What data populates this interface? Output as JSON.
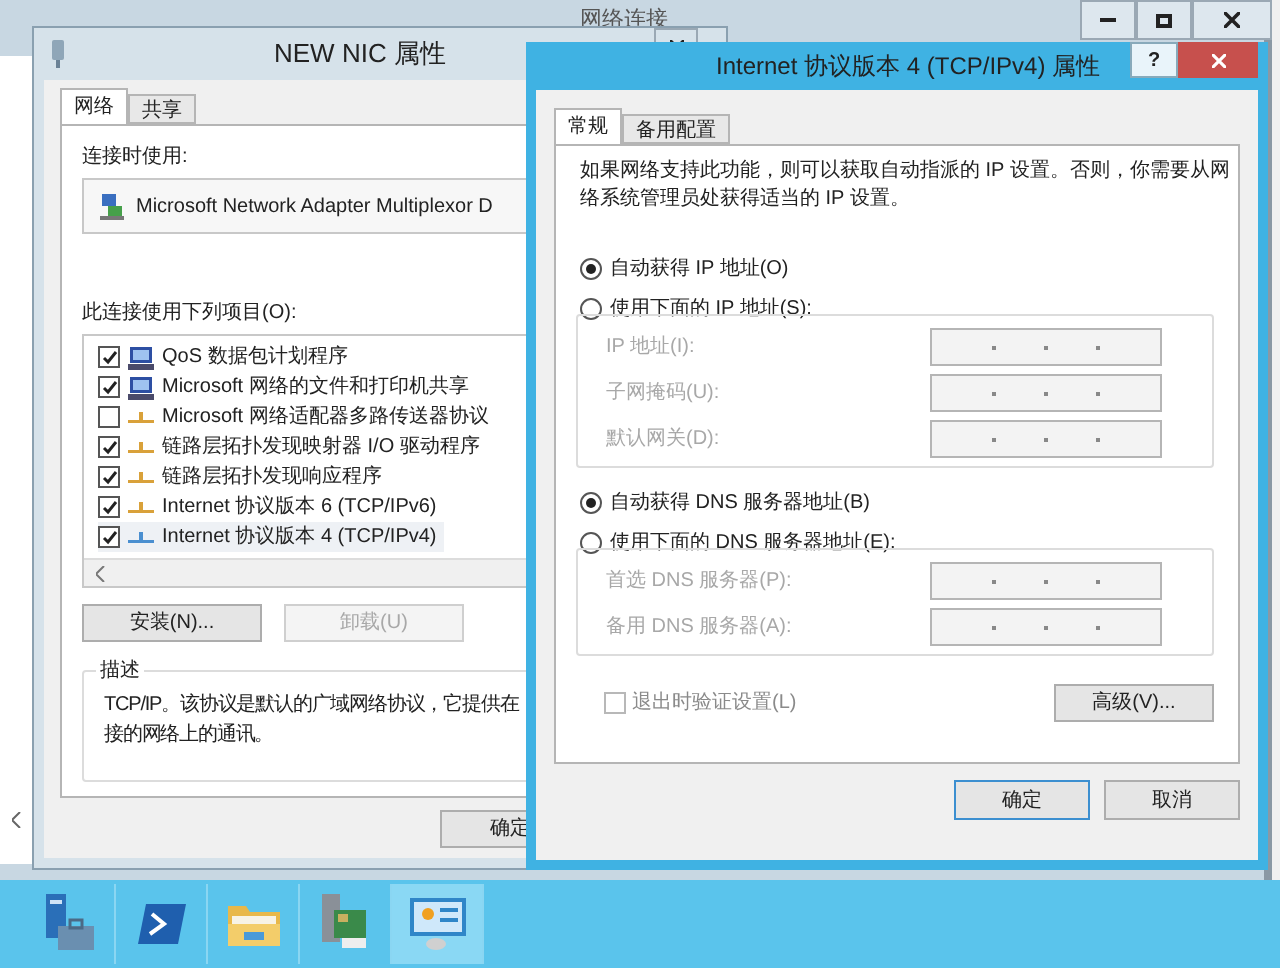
{
  "background_window": {
    "title": "网络连接"
  },
  "nic_window": {
    "title": "NEW NIC 属性",
    "tabs": [
      {
        "label": "网络",
        "selected": true
      },
      {
        "label": "共享",
        "selected": false
      }
    ],
    "connect_using_label": "连接时使用:",
    "adapter": "Microsoft Network Adapter Multiplexor D",
    "items_label": "此连接使用下列项目(O):",
    "items": [
      {
        "label": "QoS 数据包计划程序",
        "checked": true,
        "selected": false,
        "kind": "service"
      },
      {
        "label": "Microsoft 网络的文件和打印机共享",
        "checked": true,
        "selected": false,
        "kind": "service"
      },
      {
        "label": "Microsoft 网络适配器多路传送器协议",
        "checked": false,
        "selected": false,
        "kind": "protocol",
        "color": "#d9a13a"
      },
      {
        "label": "链路层拓扑发现映射器 I/O 驱动程序",
        "checked": true,
        "selected": false,
        "kind": "protocol",
        "color": "#d9a13a"
      },
      {
        "label": "链路层拓扑发现响应程序",
        "checked": true,
        "selected": false,
        "kind": "protocol",
        "color": "#d9a13a"
      },
      {
        "label": "Internet 协议版本 6 (TCP/IPv6)",
        "checked": true,
        "selected": false,
        "kind": "protocol",
        "color": "#d9a13a"
      },
      {
        "label": "Internet 协议版本 4 (TCP/IPv4)",
        "checked": true,
        "selected": true,
        "kind": "protocol",
        "color": "#4a8fd0"
      }
    ],
    "buttons": [
      {
        "label": "安装(N)...",
        "disabled": false
      },
      {
        "label": "卸载(U)",
        "disabled": true
      }
    ],
    "description": {
      "title": "描述",
      "lines": [
        "TCP/IP。该协议是默认的广域网络协议，它提供在",
        "接的网络上的通讯。"
      ]
    },
    "ok_button": "确定"
  },
  "ipv4_dialog": {
    "title": "Internet 协议版本 4 (TCP/IPv4) 属性",
    "tabs": [
      {
        "label": "常规",
        "selected": true
      },
      {
        "label": "备用配置",
        "selected": false
      }
    ],
    "intro": "如果网络支持此功能，则可以获取自动指派的 IP 设置。否则，你需要从网络系统管理员处获得适当的 IP 设置。",
    "ip_options": [
      {
        "label": "自动获得 IP 地址(O)",
        "selected": true
      },
      {
        "label": "使用下面的 IP 地址(S):",
        "selected": false
      }
    ],
    "ip_fields": [
      {
        "label": "IP 地址(I):",
        "disabled": true
      },
      {
        "label": "子网掩码(U):",
        "disabled": true
      },
      {
        "label": "默认网关(D):",
        "disabled": true
      }
    ],
    "dns_options": [
      {
        "label": "自动获得 DNS 服务器地址(B)",
        "selected": true
      },
      {
        "label": "使用下面的 DNS 服务器地址(E):",
        "selected": false
      }
    ],
    "dns_fields": [
      {
        "label": "首选 DNS 服务器(P):",
        "disabled": true
      },
      {
        "label": "备用 DNS 服务器(A):",
        "disabled": true
      }
    ],
    "validate": {
      "label": "退出时验证设置(L)",
      "checked": false,
      "disabled": true
    },
    "help_button": "?",
    "advanced_button": "高级(V)...",
    "ok_button": "确定",
    "cancel_button": "取消"
  },
  "taskbar": {
    "apps": [
      {
        "kind": "server",
        "selected": false
      },
      {
        "kind": "shell",
        "selected": false
      },
      {
        "kind": "folder",
        "selected": false
      },
      {
        "kind": "devices",
        "selected": false
      },
      {
        "kind": "panel",
        "selected": true
      }
    ]
  }
}
